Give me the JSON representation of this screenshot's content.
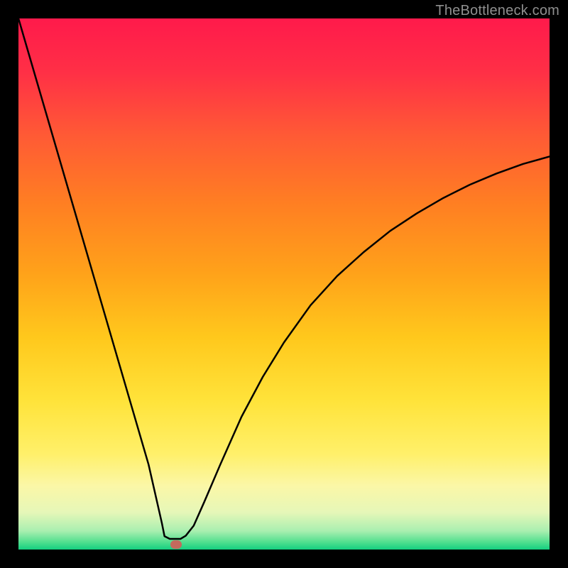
{
  "watermark": "TheBottleneck.com",
  "colors": {
    "accent_marker": "#c36a5d",
    "curve_stroke": "#000000",
    "frame_border": "#000000"
  },
  "gradient_stops": [
    {
      "offset": 0.0,
      "color": "#ff1a4b"
    },
    {
      "offset": 0.1,
      "color": "#ff2f46"
    },
    {
      "offset": 0.22,
      "color": "#ff5a35"
    },
    {
      "offset": 0.35,
      "color": "#ff7f22"
    },
    {
      "offset": 0.48,
      "color": "#ffa21a"
    },
    {
      "offset": 0.6,
      "color": "#ffc81c"
    },
    {
      "offset": 0.72,
      "color": "#ffe33a"
    },
    {
      "offset": 0.82,
      "color": "#fff06a"
    },
    {
      "offset": 0.88,
      "color": "#fbf7a7"
    },
    {
      "offset": 0.93,
      "color": "#e6f7b8"
    },
    {
      "offset": 0.965,
      "color": "#a9efb0"
    },
    {
      "offset": 0.985,
      "color": "#55e090"
    },
    {
      "offset": 1.0,
      "color": "#14cf80"
    }
  ],
  "chart_data": {
    "type": "line",
    "title": "",
    "xlabel": "",
    "ylabel": "",
    "xlim": [
      0,
      100
    ],
    "ylim": [
      0,
      100
    ],
    "marker": {
      "x": 29.7,
      "y": 1.0
    },
    "series": [
      {
        "name": "bottleneck-curve",
        "x": [
          0,
          3.5,
          7,
          10.5,
          14,
          17.5,
          21,
          24.5,
          27,
          27.5,
          28.5,
          30.5,
          31.5,
          33,
          35,
          38,
          42,
          46,
          50,
          55,
          60,
          65,
          70,
          75,
          80,
          85,
          90,
          95,
          100
        ],
        "y": [
          100,
          88,
          76,
          64,
          52,
          40,
          28,
          16,
          5,
          2.5,
          2,
          2,
          2.6,
          4.5,
          9,
          16,
          25,
          32.5,
          39,
          46,
          51.5,
          56,
          60,
          63.3,
          66.2,
          68.7,
          70.8,
          72.6,
          74
        ]
      }
    ]
  }
}
